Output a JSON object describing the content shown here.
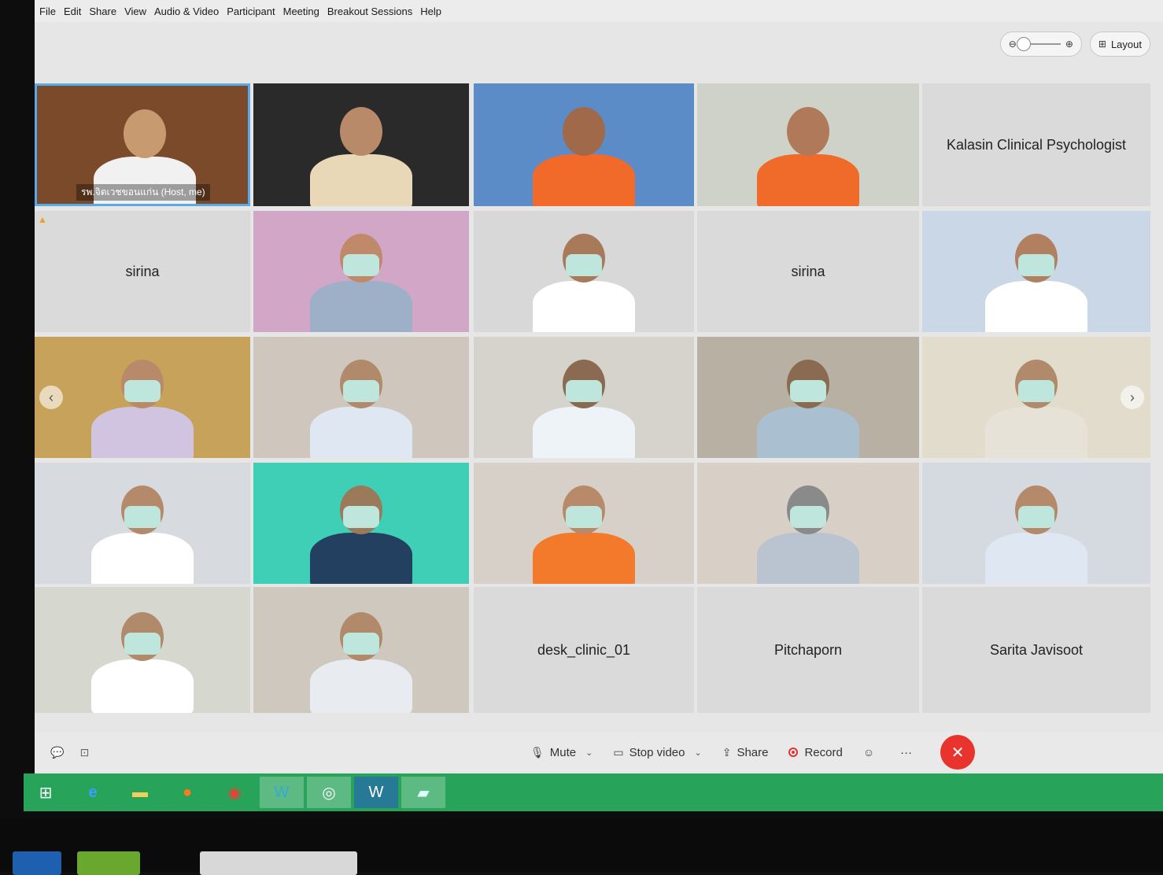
{
  "menu": [
    "File",
    "Edit",
    "Share",
    "View",
    "Audio & Video",
    "Participant",
    "Meeting",
    "Breakout Sessions",
    "Help"
  ],
  "top_controls": {
    "layout_label": "Layout",
    "zoom_out_icon": "zoom-out-icon",
    "zoom_in_icon": "zoom-in-icon"
  },
  "tiles": [
    {
      "name": "รพ.จิตเวชขอนแก่น (Host, me)",
      "video": true,
      "host": true
    },
    {
      "name": "",
      "video": true
    },
    {
      "name": "",
      "video": true
    },
    {
      "name": "",
      "video": true
    },
    {
      "name": "Kalasin Clinical Psychologist",
      "video": false
    },
    {
      "name": "sirina",
      "video": false
    },
    {
      "name": "",
      "video": true
    },
    {
      "name": "",
      "video": true
    },
    {
      "name": "sirina",
      "video": false
    },
    {
      "name": "",
      "video": true
    },
    {
      "name": "",
      "video": true
    },
    {
      "name": "",
      "video": true
    },
    {
      "name": "",
      "video": true
    },
    {
      "name": "",
      "video": true
    },
    {
      "name": "",
      "video": true
    },
    {
      "name": "",
      "video": true
    },
    {
      "name": "",
      "video": true
    },
    {
      "name": "",
      "video": true
    },
    {
      "name": "",
      "video": true
    },
    {
      "name": "",
      "video": true
    },
    {
      "name": "",
      "video": true
    },
    {
      "name": "",
      "video": true
    },
    {
      "name": "desk_clinic_01",
      "video": false
    },
    {
      "name": "Pitchaporn",
      "video": false
    },
    {
      "name": "Sarita Javisoot",
      "video": false
    }
  ],
  "toolbar": {
    "mute_label": "Mute",
    "stop_video_label": "Stop video",
    "share_label": "Share",
    "record_label": "Record",
    "more_label": "···",
    "end_label": "✕"
  },
  "colors": {
    "end_red": "#e8342d",
    "taskbar_green": "#27a35a",
    "host_border": "#5aa9e6"
  }
}
